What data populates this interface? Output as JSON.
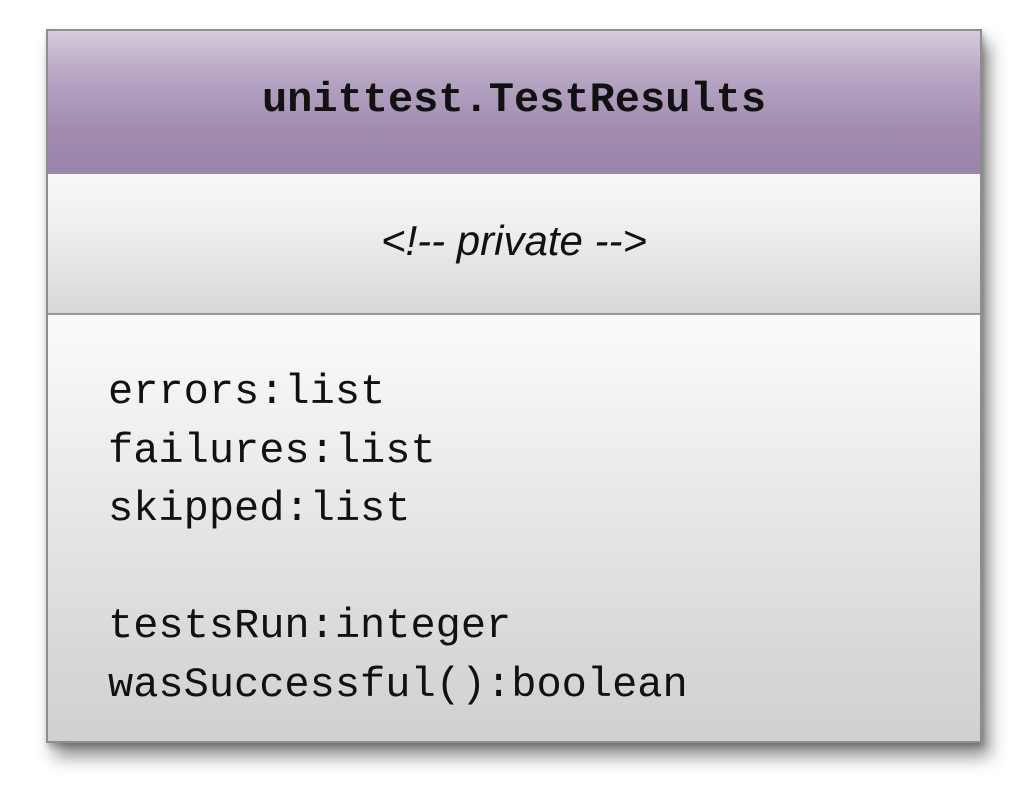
{
  "diagram": {
    "class_name": "unittest.TestResults",
    "private_section": "<!-- private -->",
    "members": [
      "errors:list",
      "failures:list",
      "skipped:list",
      "",
      "testsRun:integer",
      "wasSuccessful():boolean"
    ]
  },
  "colors": {
    "header_purple": "#a18cb0",
    "body_gray": "#d9d9d9",
    "border": "#8e8e8e",
    "text": "#111111"
  }
}
